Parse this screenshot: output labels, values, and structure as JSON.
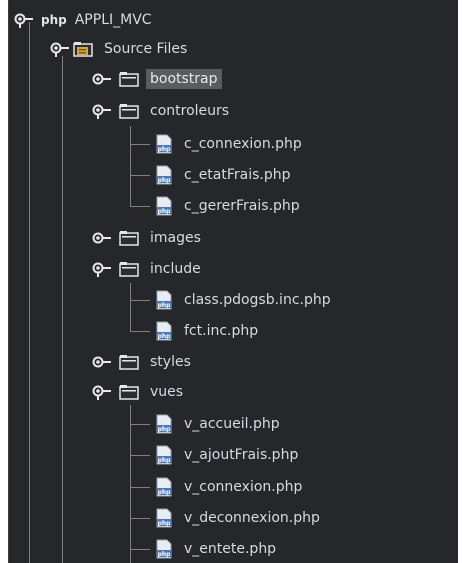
{
  "project": {
    "badge": "php",
    "name": "APPLI_MVC"
  },
  "source_files": "Source Files",
  "folders": {
    "bootstrap": "bootstrap",
    "controleurs": "controleurs",
    "images": "images",
    "include": "include",
    "styles": "styles",
    "vues": "vues"
  },
  "files": {
    "controleurs": [
      "c_connexion.php",
      "c_etatFrais.php",
      "c_gererFrais.php"
    ],
    "include": [
      "class.pdogsb.inc.php",
      "fct.inc.php"
    ],
    "vues": [
      "v_accueil.php",
      "v_ajoutFrais.php",
      "v_connexion.php",
      "v_deconnexion.php",
      "v_entete.php"
    ]
  },
  "file_icon_text": "php",
  "colors": {
    "panel_bg": "#25272b",
    "selection": "#5a5c60",
    "tree_line": "#7d8085",
    "text": "#d7dadf"
  },
  "selected_item": "bootstrap"
}
